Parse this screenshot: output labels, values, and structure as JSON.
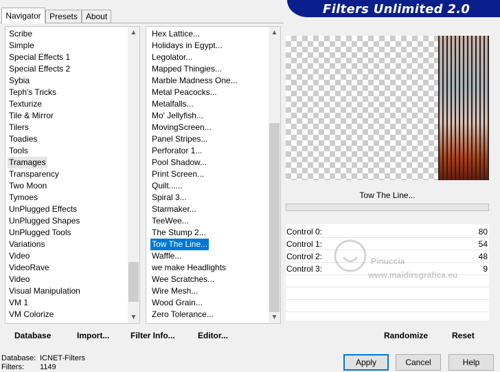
{
  "banner": {
    "title": "Filters Unlimited 2.0"
  },
  "tabs": [
    {
      "label": "Navigator",
      "active": true
    },
    {
      "label": "Presets",
      "active": false
    },
    {
      "label": "About",
      "active": false
    }
  ],
  "categories": {
    "items": [
      "Scribe",
      "Simple",
      "Special Effects 1",
      "Special Effects 2",
      "Sybia",
      "Teph's Tricks",
      "Texturize",
      "Tile & Mirror",
      "Tilers",
      "Toadies",
      "Tools",
      "Tramages",
      "Transparency",
      "Two Moon",
      "Tymoes",
      "UnPlugged Effects",
      "UnPlugged Shapes",
      "UnPlugged Tools",
      "Variations",
      "Video",
      "VideoRave",
      "Video",
      "Visual Manipulation",
      "VM 1",
      "VM Colorize"
    ],
    "selected_index": 11
  },
  "filters": {
    "items": [
      "Hex Lattice...",
      "Holidays in Egypt...",
      "Legolator...",
      "Mapped Thingies...",
      "Marble Madness One...",
      "Metal Peacocks...",
      "Metalfalls...",
      "Mo' Jellyfish...",
      "MovingScreen...",
      "Panel Stripes...",
      "Perforator 1...",
      "Pool Shadow...",
      "Print Screen...",
      "Quilt......",
      "Spiral 3...",
      "Starmaker...",
      "TeeWee...",
      "The Stump 2...",
      "Tow The Line...",
      "Waffle...",
      "we make Headlights",
      "Wee Scratches...",
      "Wire Mesh...",
      "Wood Grain...",
      "Zero Tolerance..."
    ],
    "selected_index": 18
  },
  "preview": {
    "filter_name": "Tow The Line...",
    "colors": {
      "checker_light": "#ffffff",
      "checker_dark": "#cccccc",
      "stripe": "#2a2020"
    }
  },
  "controls": [
    {
      "label": "Control 0:",
      "value": "80"
    },
    {
      "label": "Control 1:",
      "value": "54"
    },
    {
      "label": "Control 2:",
      "value": "48"
    },
    {
      "label": "Control 3:",
      "value": "9"
    }
  ],
  "watermark": {
    "line1": "Pinuccia",
    "line2": "www.maidirsgrafica.eu"
  },
  "left_buttons": {
    "database": "Database",
    "import": "Import...",
    "filter_info": "Filter Info...",
    "editor": "Editor..."
  },
  "right_buttons": {
    "randomize": "Randomize",
    "reset": "Reset"
  },
  "status": {
    "database_label": "Database:",
    "database_value": "ICNET-Filters",
    "filters_label": "Filters:",
    "filters_value": "1149"
  },
  "dialog_buttons": {
    "apply": "Apply",
    "cancel": "Cancel",
    "help": "Help"
  },
  "icons": {
    "scroll_up": "▲",
    "scroll_down": "▼"
  },
  "accent": "#0078d7",
  "banner_color": "#0a1e8c"
}
